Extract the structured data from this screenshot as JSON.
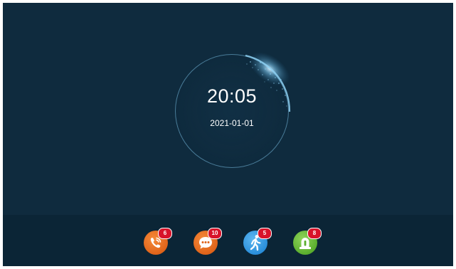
{
  "clock": {
    "time": "20:05",
    "date": "2021-01-01"
  },
  "dock": {
    "items": [
      {
        "name": "calls",
        "icon": "phone-call-icon",
        "badge": "6",
        "color": "#e0641a"
      },
      {
        "name": "messages",
        "icon": "chat-bubble-icon",
        "badge": "10",
        "color": "#e0641a"
      },
      {
        "name": "motion-events",
        "icon": "walking-person-icon",
        "badge": "5",
        "color": "#2a8fdb"
      },
      {
        "name": "alarms",
        "icon": "alarm-siren-icon",
        "badge": "8",
        "color": "#5aae2e"
      }
    ]
  },
  "colors": {
    "background": "#0f2b3e",
    "dock_background": "#0b2536",
    "badge": "#d8132a",
    "text": "#ffffff"
  }
}
